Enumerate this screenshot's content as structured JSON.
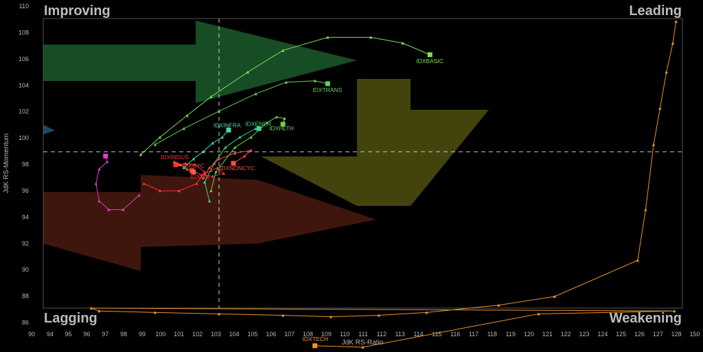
{
  "chart_data": {
    "type": "scatter",
    "xlabel": "JdK RS-Ratio",
    "ylabel": "JdK RS-Momentum",
    "xlim": [
      89,
      129
    ],
    "ylim": [
      89.2,
      109.2
    ],
    "x_ticks": [
      90,
      94,
      95,
      96,
      97,
      98,
      99,
      100,
      101,
      102,
      103,
      104,
      105,
      106,
      107,
      108,
      109,
      110,
      111,
      112,
      113,
      114,
      115,
      116,
      117,
      118,
      119,
      120,
      121,
      122,
      123,
      124,
      125,
      126,
      127,
      128,
      150
    ],
    "y_ticks": [
      86,
      88,
      90,
      92,
      94,
      96,
      98,
      100,
      102,
      104,
      106,
      108,
      110
    ],
    "quadrants": {
      "top_left": "Improving",
      "top_right": "Leading",
      "bottom_left": "Lagging",
      "bottom_right": "Weakening"
    },
    "reference": {
      "x": 100,
      "y": 100
    },
    "grid": false,
    "series": [
      {
        "name": "IDXBASIC",
        "color": "#7ee05a",
        "points": [
          [
            95.1,
            99.8
          ],
          [
            96.3,
            101.0
          ],
          [
            98.0,
            102.5
          ],
          [
            99.5,
            103.8
          ],
          [
            101.8,
            105.5
          ],
          [
            104.0,
            107.0
          ],
          [
            106.8,
            107.9
          ],
          [
            109.5,
            107.9
          ],
          [
            111.5,
            107.5
          ],
          [
            113.2,
            106.7
          ]
        ]
      },
      {
        "name": "IDXTRANS",
        "color": "#5fd45a",
        "points": [
          [
            96.0,
            100.5
          ],
          [
            97.8,
            101.6
          ],
          [
            100.0,
            102.8
          ],
          [
            102.3,
            104.0
          ],
          [
            104.2,
            104.8
          ],
          [
            106.0,
            104.9
          ],
          [
            106.8,
            104.7
          ]
        ]
      },
      {
        "name": "IDXHLTH",
        "color": "#6ad64e",
        "points": [
          [
            99.5,
            97.3
          ],
          [
            99.8,
            98.6
          ],
          [
            101.0,
            100.3
          ],
          [
            102.0,
            101.0
          ],
          [
            103.0,
            102.0
          ],
          [
            103.6,
            102.4
          ],
          [
            104.1,
            102.3
          ],
          [
            104.0,
            101.9
          ]
        ]
      },
      {
        "name": "IDXENER",
        "color": "#3dd68a",
        "points": [
          [
            99.4,
            96.6
          ],
          [
            99.1,
            97.9
          ],
          [
            99.7,
            99.2
          ],
          [
            100.4,
            100.3
          ],
          [
            101.3,
            101.0
          ],
          [
            102.3,
            101.6
          ],
          [
            102.5,
            101.6
          ]
        ]
      },
      {
        "name": "IDXINFRA",
        "color": "#4dd6b0",
        "points": [
          [
            97.8,
            98.9
          ],
          [
            98.4,
            99.5
          ],
          [
            99.0,
            100.0
          ],
          [
            99.6,
            100.6
          ],
          [
            100.2,
            101.0
          ],
          [
            100.6,
            101.5
          ]
        ]
      },
      {
        "name": "IDXNONCYC",
        "color": "#ff4a4a",
        "points": [
          [
            99.0,
            98.2
          ],
          [
            99.4,
            98.9
          ],
          [
            100.0,
            99.5
          ],
          [
            101.0,
            99.9
          ],
          [
            102.0,
            100.1
          ],
          [
            101.6,
            99.7
          ],
          [
            100.9,
            99.2
          ]
        ]
      },
      {
        "name": "IDXFIN",
        "color": "#e83838",
        "points": [
          [
            99.1,
            98.5
          ],
          [
            99.5,
            98.7
          ],
          [
            99.9,
            98.9
          ],
          [
            100.3,
            98.5
          ],
          [
            99.6,
            98.3
          ],
          [
            98.9,
            98.4
          ],
          [
            98.3,
            98.7
          ]
        ]
      },
      {
        "name": "IDXINDUS",
        "color": "#ff3030",
        "points": [
          [
            95.3,
            97.8
          ],
          [
            96.3,
            97.3
          ],
          [
            97.5,
            97.3
          ],
          [
            98.6,
            97.8
          ],
          [
            99.1,
            98.6
          ],
          [
            98.5,
            99.1
          ],
          [
            97.9,
            99.2
          ],
          [
            97.5,
            99.1
          ],
          [
            97.3,
            99.1
          ]
        ]
      },
      {
        "name": "IDXCYC",
        "color": "#ff5a4a",
        "points": [
          [
            97.2,
            99.3
          ],
          [
            97.6,
            99.1
          ],
          [
            98.0,
            98.8
          ],
          [
            98.4,
            98.6
          ]
        ]
      },
      {
        "name": "IDXCYC",
        "color": "#e040c8",
        "points": [
          [
            95.0,
            97.0
          ],
          [
            94.0,
            96.0
          ],
          [
            93.1,
            96.0
          ],
          [
            92.5,
            96.6
          ],
          [
            92.3,
            97.8
          ],
          [
            92.5,
            98.8
          ],
          [
            93.0,
            99.3
          ],
          [
            92.9,
            99.7
          ]
        ]
      },
      {
        "name": "IDXTECH",
        "color": "#f0932a",
        "points": [
          [
            128.6,
            109.0
          ],
          [
            128.4,
            107.5
          ],
          [
            128.0,
            105.5
          ],
          [
            127.6,
            103.0
          ],
          [
            127.2,
            100.5
          ],
          [
            126.7,
            96.0
          ],
          [
            126.2,
            92.5
          ],
          [
            121.0,
            90.0
          ],
          [
            117.5,
            89.4
          ],
          [
            113.0,
            88.9
          ],
          [
            110.0,
            88.7
          ],
          [
            107.0,
            88.6
          ],
          [
            104.0,
            88.7
          ],
          [
            100.0,
            88.8
          ],
          [
            96.0,
            88.9
          ],
          [
            92.5,
            89.0
          ],
          [
            92.0,
            89.2
          ],
          [
            128.5,
            89.0
          ],
          [
            120.0,
            88.8
          ],
          [
            109.0,
            86.5
          ],
          [
            106.0,
            86.6
          ]
        ]
      }
    ]
  },
  "labels": {
    "IDXBASIC": "IDXBASIC",
    "IDXTRANS": "IDXTRANS",
    "IDXHLTH": "IDXHLTH",
    "IDXENER": "IDXENER",
    "IDXINFRA": "IDXINFRA",
    "IDXNONCYC": "IDXNONCYC",
    "IDXFIN": "IDXFIN",
    "IDXINDUS": "IDXINDUS",
    "IDXCYC": "IDXCYC",
    "IDXTECH": "IDXTECH"
  }
}
